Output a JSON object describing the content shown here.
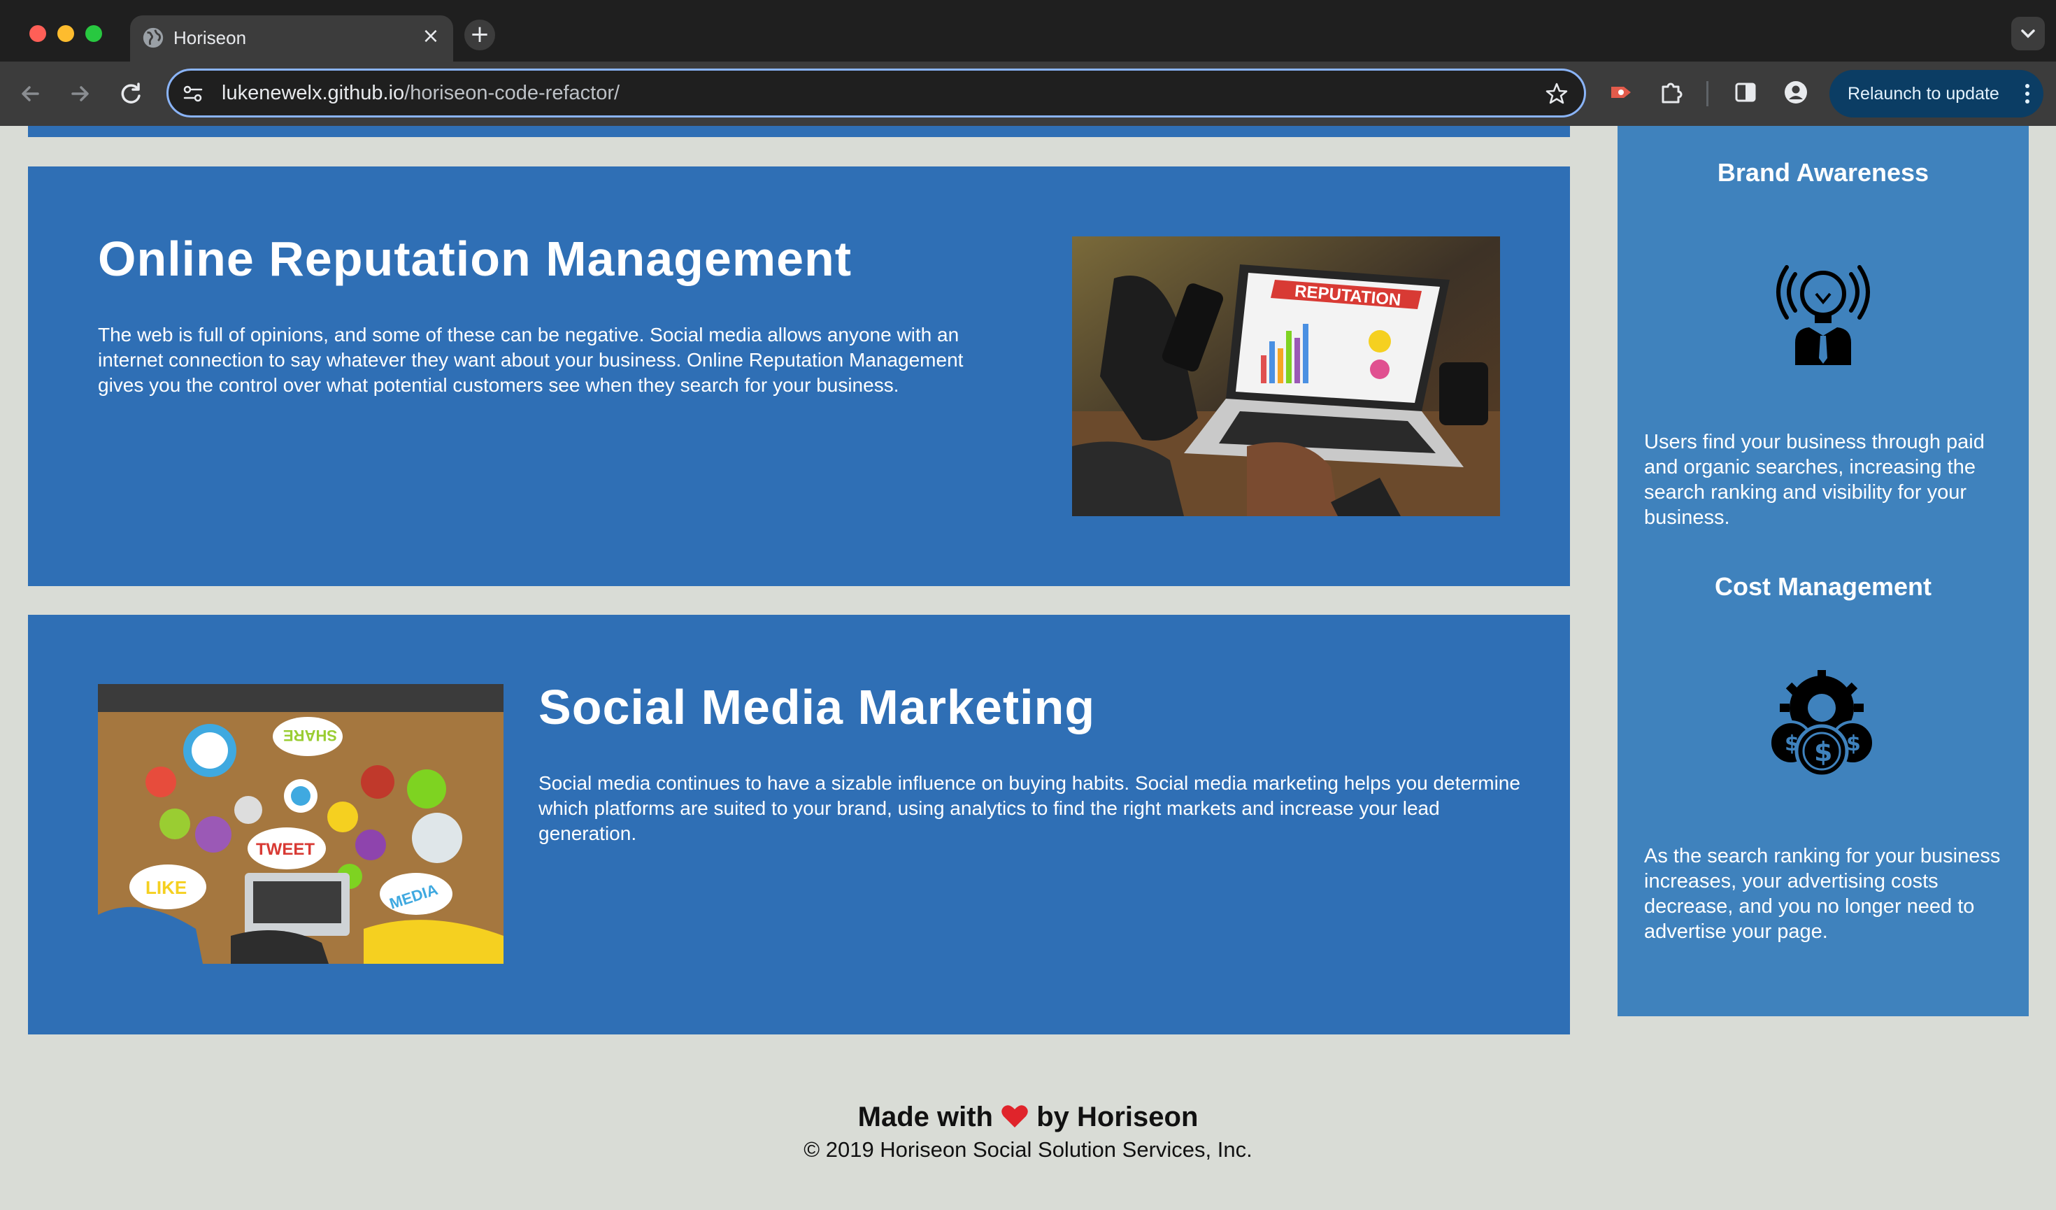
{
  "browser": {
    "tab_title": "Horiseon",
    "tab_close": "×",
    "new_tab": "+",
    "url_host": "lukenewelx.github.io",
    "url_path": "/horiseon-code-refactor/",
    "relaunch_label": "Relaunch to update"
  },
  "sections": [
    {
      "title": "Online Reputation Management",
      "body": "The web is full of opinions, and some of these can be negative. Social media allows anyone with an internet connection to say whatever they want about your business. Online Reputation Management gives you the control over what potential customers see when they search for your business.",
      "image_text": "REPUTATION"
    },
    {
      "title": "Social Media Marketing",
      "body": "Social media continues to have a sizable influence on buying habits. Social media marketing helps you determine which platforms are suited to your brand, using analytics to find the right markets and increase your lead generation.",
      "image_words": [
        "SHARE",
        "TWEET",
        "LIKE",
        "MEDIA"
      ]
    }
  ],
  "benefits": [
    {
      "title": "Brand Awareness",
      "icon": "lightbulb-person-icon",
      "body": "Users find your business through paid and organic searches, increasing the search ranking and visibility for your business."
    },
    {
      "title": "Cost Management",
      "icon": "gear-coins-icon",
      "body": "As the search ranking for your business increases, your advertising costs decrease, and you no longer need to advertise your page."
    }
  ],
  "footer": {
    "made_prefix": "Made with",
    "made_suffix": "by Horiseon",
    "copyright": "© 2019 Horiseon Social Solution Services, Inc."
  },
  "colors": {
    "section_blue": "#2f6fb5",
    "aside_blue": "#3f82bd",
    "page_bg": "#d9dcd6"
  }
}
